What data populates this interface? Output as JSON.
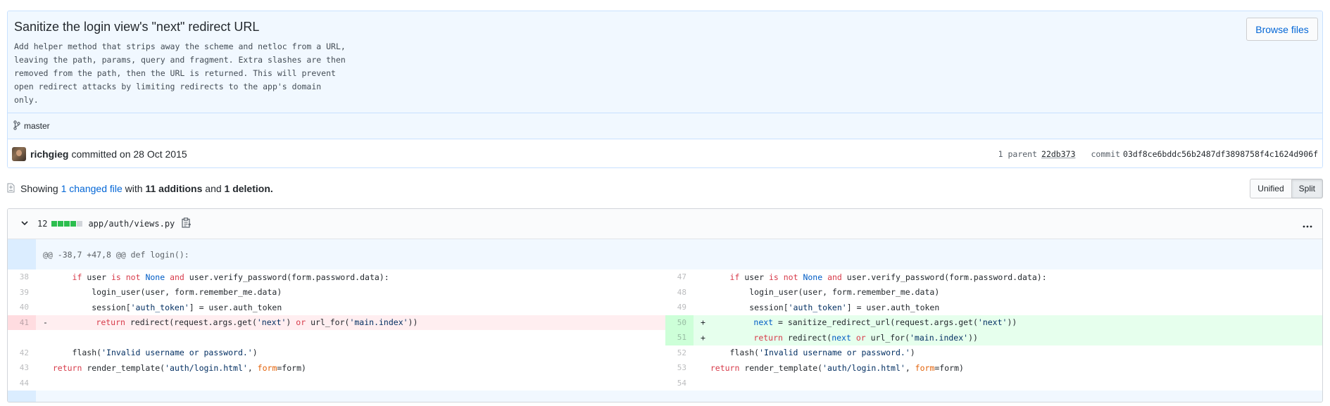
{
  "commit": {
    "title": "Sanitize the login view's \"next\" redirect URL",
    "description_lines": [
      "Add helper method that strips away the scheme and netloc from a URL,",
      "leaving the path, params, query and fragment. Extra slashes are then",
      "removed from the path, then the URL is returned. This will prevent",
      "open redirect attacks by limiting redirects to the app's domain",
      "only."
    ],
    "browse_label": "Browse files",
    "branch": "master",
    "author": "richgieg",
    "committed_text": "committed on 28 Oct 2015",
    "parent_label": "1 parent",
    "parent_sha": "22db373",
    "commit_label": "commit",
    "commit_sha": "03df8ce6bddc56b2487df3898758f4c1624d906f"
  },
  "summary": {
    "showing": "Showing",
    "changed_files": "1 changed file",
    "with": "with",
    "additions": "11 additions",
    "and": "and",
    "deletions": "1 deletion",
    "period": ".",
    "unified_label": "Unified",
    "split_label": "Split"
  },
  "file": {
    "change_count": "12",
    "path": "app/auth/views.py",
    "hunk_header": "@@ -38,7 +47,8 @@ def login():",
    "left_numbers": [
      "38",
      "39",
      "40",
      "41",
      "",
      "42",
      "43",
      "44"
    ],
    "right_numbers": [
      "47",
      "48",
      "49",
      "50",
      "51",
      "52",
      "53",
      "54"
    ]
  },
  "colors": {
    "accent": "#0366d6",
    "addition": "#2cbe4e",
    "deletion_bg": "#ffeef0",
    "addition_bg": "#e6ffed",
    "commit_bg": "#f1f8ff"
  },
  "icons": [
    "branch-icon",
    "file-diff-icon",
    "chevron-down-icon",
    "clipboard-icon",
    "kebab-icon",
    "unfold-icon",
    "fold-icon"
  ]
}
